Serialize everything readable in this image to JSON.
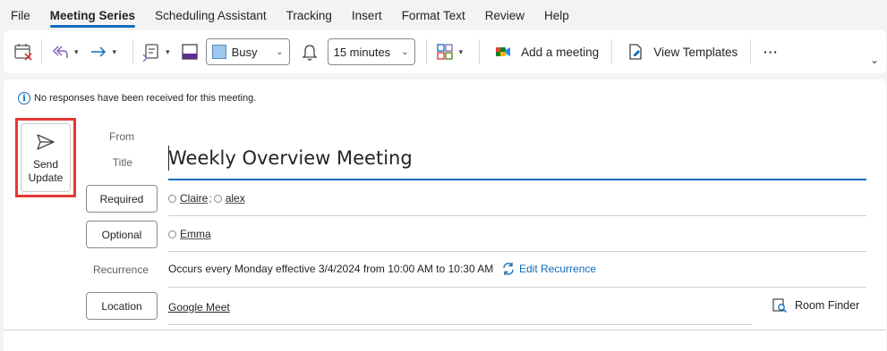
{
  "menu": {
    "tabs": [
      "File",
      "Meeting Series",
      "Scheduling Assistant",
      "Tracking",
      "Insert",
      "Format Text",
      "Review",
      "Help"
    ],
    "active": "Meeting Series"
  },
  "ribbon": {
    "show_as": "Busy",
    "reminder": "15 minutes",
    "add_meeting": "Add a meeting",
    "view_templates": "View Templates",
    "more": "···"
  },
  "info_bar": {
    "text": "No responses have been received for this meeting."
  },
  "send_button": {
    "line1": "Send",
    "line2": "Update"
  },
  "form": {
    "from_label": "From",
    "title_label": "Title",
    "title_value": "Weekly Overview Meeting",
    "required_label": "Required",
    "required_attendees": [
      "Claire",
      "alex"
    ],
    "optional_label": "Optional",
    "optional_attendees": [
      "Emma"
    ],
    "recurrence_label": "Recurrence",
    "recurrence_text": "Occurs every Monday effective 3/4/2024 from 10:00 AM to 10:30 AM",
    "edit_recurrence": "Edit Recurrence",
    "location_label": "Location",
    "location_value": "Google Meet",
    "room_finder": "Room Finder"
  },
  "colors": {
    "accent": "#0f6cbd",
    "highlight_border": "#e53935",
    "busy_swatch": "#9fc6ec"
  }
}
